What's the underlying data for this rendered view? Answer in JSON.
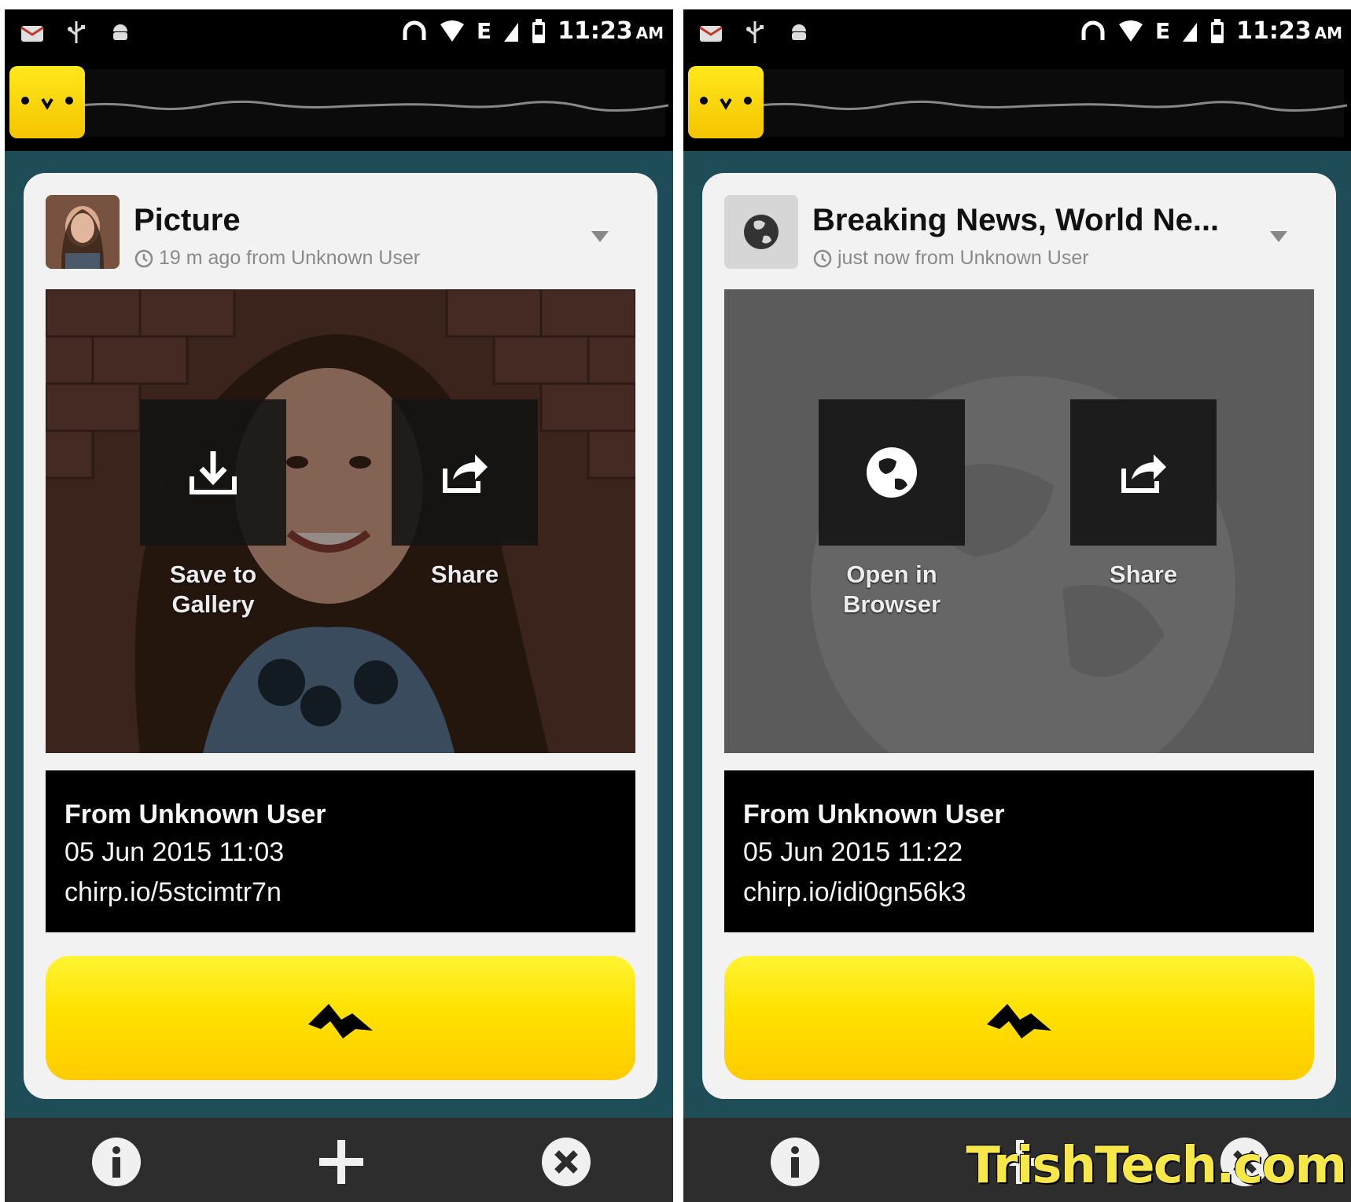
{
  "status_bar": {
    "time": "11:23",
    "ampm": "AM",
    "network": "E"
  },
  "screens": [
    {
      "card": {
        "title": "Picture",
        "meta": "19 m ago from Unknown User",
        "actions": [
          {
            "label_line1": "Save to",
            "label_line2": "Gallery",
            "icon": "download-icon"
          },
          {
            "label_line1": "Share",
            "label_line2": "",
            "icon": "share-icon"
          }
        ],
        "info": {
          "from": "From Unknown User",
          "date": "05 Jun 2015 11:03",
          "link": "chirp.io/5stcimtr7n"
        }
      }
    },
    {
      "card": {
        "title": "Breaking News, World Ne...",
        "meta": "just now from Unknown User",
        "actions": [
          {
            "label_line1": "Open in",
            "label_line2": "Browser",
            "icon": "globe-icon"
          },
          {
            "label_line1": "Share",
            "label_line2": "",
            "icon": "share-icon"
          }
        ],
        "info": {
          "from": "From Unknown User",
          "date": "05 Jun 2015 11:22",
          "link": "chirp.io/idi0gn56k3"
        }
      }
    }
  ],
  "bottom_bar": {
    "buttons": [
      "info-icon",
      "add-icon",
      "close-icon"
    ]
  },
  "watermark": "TrishTech.com",
  "colors": {
    "accent_yellow": "#ffe100",
    "background_teal": "#1f4d57",
    "card": "#f2f2f2"
  }
}
